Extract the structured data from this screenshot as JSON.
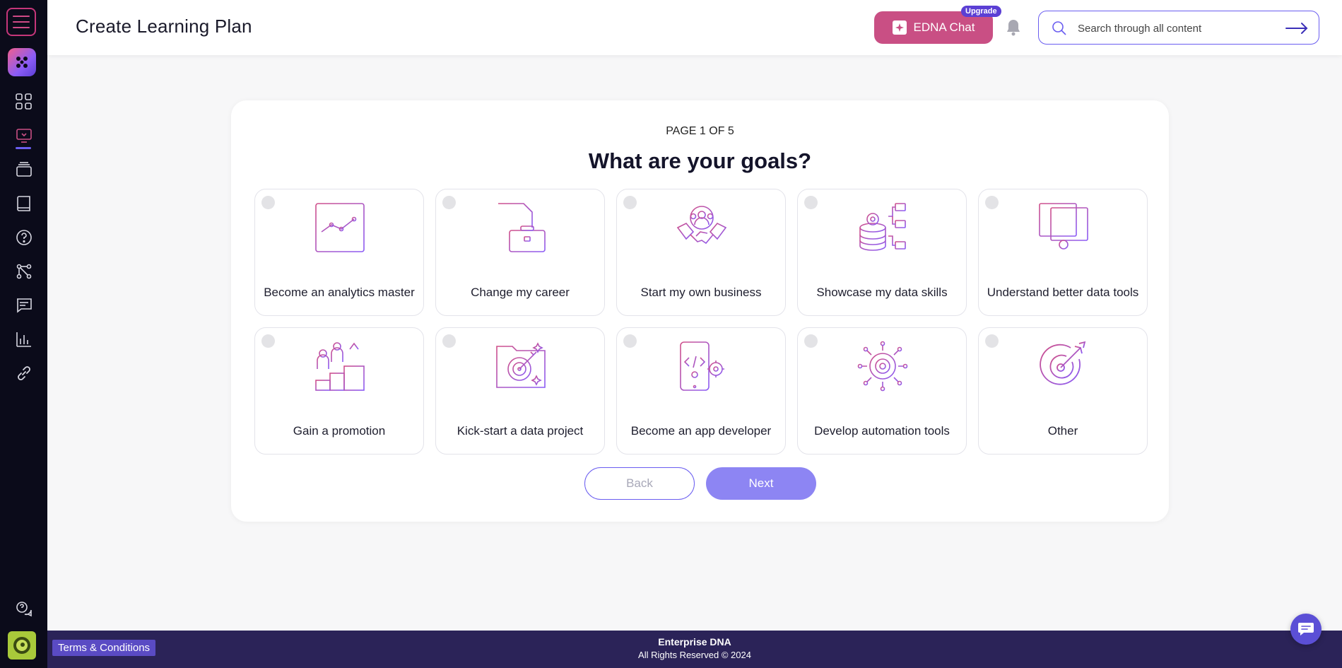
{
  "header": {
    "title": "Create Learning Plan",
    "chat_label": "EDNA Chat",
    "upgrade_badge": "Upgrade",
    "search_placeholder": "Search through all content"
  },
  "sidebar": {
    "items": [
      {
        "name": "menu-icon"
      },
      {
        "name": "brand-logo-icon"
      },
      {
        "name": "dashboard-grid-icon"
      },
      {
        "name": "learning-monitor-icon",
        "active": true
      },
      {
        "name": "courses-stack-icon"
      },
      {
        "name": "book-icon"
      },
      {
        "name": "help-question-icon"
      },
      {
        "name": "workflow-nodes-icon"
      },
      {
        "name": "forum-chat-icon"
      },
      {
        "name": "analytics-bars-icon"
      },
      {
        "name": "link-icon"
      },
      {
        "name": "support-chat-icon"
      },
      {
        "name": "user-avatar-icon"
      }
    ]
  },
  "wizard": {
    "page_indicator": "PAGE 1 OF 5",
    "question": "What are your goals?",
    "options": [
      {
        "label": "Become an analytics master",
        "icon": "analytics-chart-icon",
        "selected": false
      },
      {
        "label": "Change my career",
        "icon": "briefcase-document-icon",
        "selected": false
      },
      {
        "label": "Start my own business",
        "icon": "handshake-gear-icon",
        "selected": false
      },
      {
        "label": "Showcase my data skills",
        "icon": "database-gear-icon",
        "selected": false
      },
      {
        "label": "Understand better data tools",
        "icon": "dashboard-tools-icon",
        "selected": false
      },
      {
        "label": "Gain a promotion",
        "icon": "promotion-podium-icon",
        "selected": false
      },
      {
        "label": "Kick-start a data project",
        "icon": "folder-target-icon",
        "selected": false
      },
      {
        "label": "Become an app developer",
        "icon": "mobile-code-icon",
        "selected": false
      },
      {
        "label": "Develop automation tools",
        "icon": "automation-gear-icon",
        "selected": false
      },
      {
        "label": "Other",
        "icon": "target-arrow-icon",
        "selected": false
      }
    ],
    "back_label": "Back",
    "next_label": "Next"
  },
  "footer": {
    "terms_label": "Terms & Conditions",
    "brand": "Enterprise DNA",
    "copyright": "All Rights Reserved © 2024"
  },
  "colors": {
    "sidebar_bg": "#0b0b1a",
    "accent_purple": "#6a5df0",
    "chat_pink": "#c94f84",
    "next_button": "#8d85f3",
    "footer_bg": "#2b2358",
    "icon_gradient_start": "#c94f84",
    "icon_gradient_end": "#8b5cf6"
  }
}
